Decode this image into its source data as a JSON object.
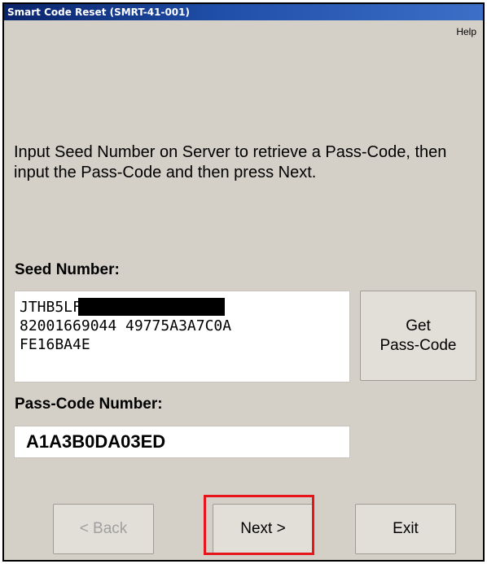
{
  "window": {
    "title": "Smart Code Reset (SMRT-41-001)",
    "menu_help": "Help"
  },
  "instruction": "Input Seed Number on Server to retrieve a Pass-Code, then input the Pass-Code and then press Next.",
  "seed": {
    "label": "Seed Number:",
    "line1": "JTHB5LF",
    "line2": "82001669044 49775A3A7C0A",
    "line3": "FE16BA4E",
    "redacted": true
  },
  "get_passcode": {
    "line1": "Get",
    "line2": "Pass-Code"
  },
  "passcode": {
    "label": "Pass-Code Number:",
    "value": "A1A3B0DA03ED"
  },
  "buttons": {
    "back": "< Back",
    "next": "Next >",
    "exit": "Exit"
  },
  "highlight": {
    "target": "next-button",
    "color": "#e8141c"
  },
  "colors": {
    "title_bar": "#0a246a",
    "window_bg": "#d4d0c8"
  }
}
